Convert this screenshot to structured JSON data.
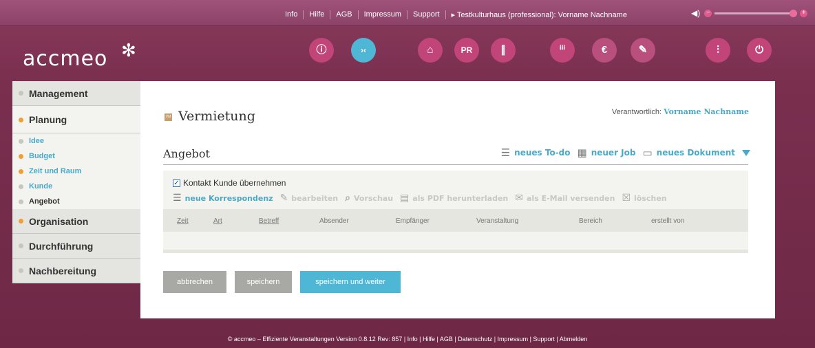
{
  "topnav": {
    "links": [
      "Info",
      "Hilfe",
      "AGB",
      "Impressum",
      "Support"
    ],
    "user": "▸ Testkulturhaus (professional): Vorname Nachname",
    "volume_minus": "−",
    "volume_plus": "+"
  },
  "header": {
    "logo": "accmeo",
    "icons": [
      {
        "name": "info-icon",
        "glyph": "ⓘ"
      },
      {
        "name": "collapse-icon",
        "glyph": "›‹"
      },
      {
        "name": "home-icon",
        "glyph": "⌂"
      },
      {
        "name": "pr-icon",
        "glyph": "PR"
      },
      {
        "name": "paperclip-icon",
        "glyph": "∥"
      },
      {
        "name": "people-icon",
        "glyph": "ⁱⁱⁱ"
      },
      {
        "name": "euro-icon",
        "glyph": "€"
      },
      {
        "name": "ticket-icon",
        "glyph": "✎"
      },
      {
        "name": "settings-sliders-icon",
        "glyph": "⫶"
      },
      {
        "name": "power-icon",
        "glyph": "⏻"
      }
    ]
  },
  "sidebar": {
    "management": "Management",
    "planung": "Planung",
    "items": [
      "Idee",
      "Budget",
      "Zeit und Raum",
      "Kunde",
      "Angebot"
    ],
    "organisation": "Organisation",
    "durchfuehrung": "Durchführung",
    "nachbereitung": "Nachbereitung"
  },
  "main": {
    "badge": "VM",
    "title": "Vermietung",
    "responsible_label": "Verantwortlich:",
    "responsible_name": "Vorname Nachname",
    "subtitle": "Angebot",
    "actions": {
      "todo": "neues To-do",
      "job": "neuer Job",
      "doc": "neues Dokument"
    },
    "checkbox_label": "Kontakt Kunde übernehmen",
    "tools": {
      "new": "neue Korrespondenz",
      "edit": "bearbeiten",
      "preview": "Vorschau",
      "pdf": "als PDF herunterladen",
      "email": "als E-Mail versenden",
      "delete": "löschen"
    },
    "columns": [
      "Zeit",
      "Art",
      "Betreff",
      "Absender",
      "Empfänger",
      "Veranstaltung",
      "Bereich",
      "erstellt von"
    ],
    "buttons": {
      "cancel": "abbrechen",
      "save": "speichern",
      "save_next": "speichern und weiter"
    }
  },
  "footer": "© accmeo – Effiziente Veranstaltungen Version 0.8.12 Rev: 857 | Info | Hilfe | AGB | Datenschutz | Impressum | Support | Abmelden",
  "colors": {
    "accent": "#4aa9c7",
    "brand": "#7a2f4f",
    "orange": "#f0a030"
  }
}
